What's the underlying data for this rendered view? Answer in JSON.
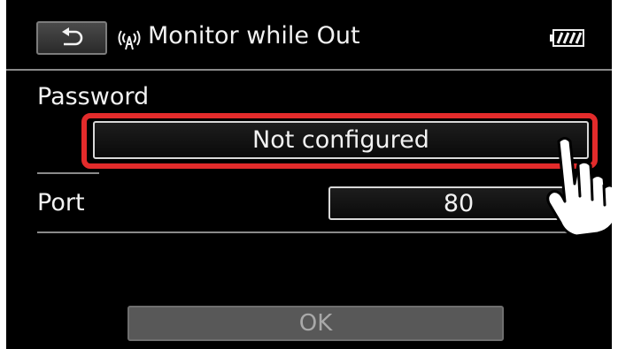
{
  "header": {
    "back_icon": "return-arrow-icon",
    "wifi_icon": "wifi-antenna-icon",
    "title": "Monitor while Out",
    "battery_icon": "battery-icon"
  },
  "password": {
    "label": "Password",
    "value": "Not configured"
  },
  "port": {
    "label": "Port",
    "value": "80"
  },
  "ok_button": {
    "label": "OK",
    "state": "disabled"
  },
  "overlay": {
    "hand_icon": "pointing-hand-icon",
    "highlight_color": "#e32b2b"
  }
}
